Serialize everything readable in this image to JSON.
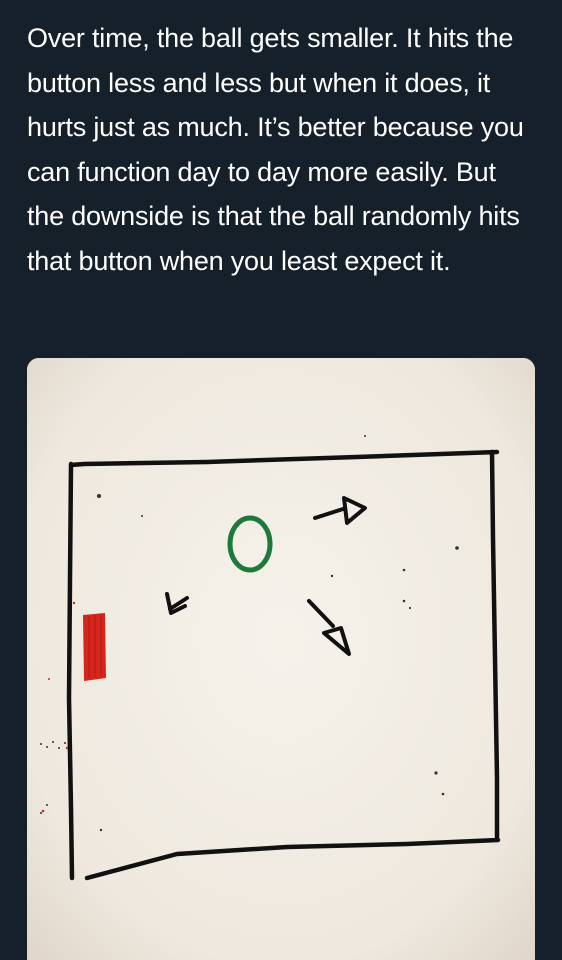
{
  "tweet": {
    "text": "Over time, the ball gets smaller. It hits the button less and less but when it does, it hurts just as much. It’s better because you can function day to day more easily. But the downside is that the ball randomly hits that button when you least expect it."
  },
  "colors": {
    "background": "#15202b",
    "text": "#ffffff",
    "paper": "#f1ece4",
    "ink": "#111111",
    "ball": "#1e7a3a",
    "button": "#d4261c"
  },
  "media": {
    "description_icons": [
      "box-drawing",
      "ball-circle",
      "button-rectangle",
      "arrow-icon"
    ]
  }
}
